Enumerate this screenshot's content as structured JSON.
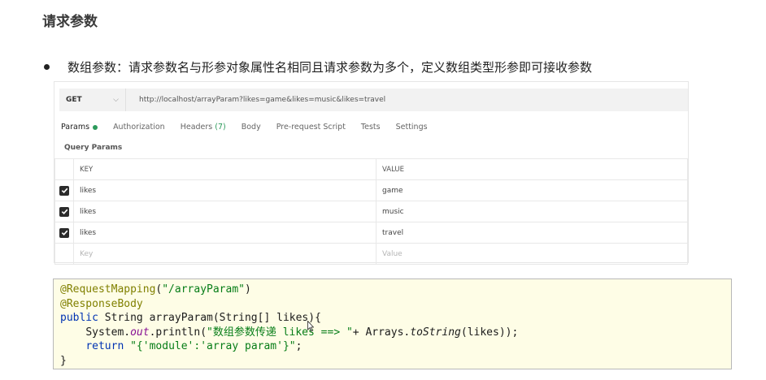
{
  "heading": "请求参数",
  "bullet": "数组参数：请求参数名与形参对象属性名相同且请求参数为多个，定义数组类型形参即可接收参数",
  "request": {
    "method": "GET",
    "url": "http://localhost/arrayParam?likes=game&likes=music&likes=travel"
  },
  "tabs": [
    {
      "label": "Params",
      "active": true
    },
    {
      "label": "Authorization"
    },
    {
      "label": "Headers",
      "count": "(7)"
    },
    {
      "label": "Body"
    },
    {
      "label": "Pre-request Script"
    },
    {
      "label": "Tests"
    },
    {
      "label": "Settings"
    }
  ],
  "query_params": {
    "title": "Query Params",
    "headers": [
      "KEY",
      "VALUE"
    ],
    "rows": [
      {
        "key": "likes",
        "value": "game",
        "checked": true
      },
      {
        "key": "likes",
        "value": "music",
        "checked": true
      },
      {
        "key": "likes",
        "value": "travel",
        "checked": true
      }
    ],
    "placeholder": {
      "key": "Key",
      "value": "Value"
    }
  },
  "code": {
    "line1_annotation": "@RequestMapping",
    "line1_path": "\"/arrayParam\"",
    "line2_annotation": "@ResponseBody",
    "line3_kw": "public",
    "line3_rest": " String arrayParam(String[] likes){",
    "line4_obj": "System.",
    "line4_field": "out",
    "line4_call": ".println(",
    "line4_str": "\"数组参数传递 likes ==> \"",
    "line4_plus": "+ Arrays.",
    "line4_method": "toString",
    "line4_end": "(likes));",
    "line5_kw": "return",
    "line5_str": "\"{'module':'array param'}\"",
    "line5_end": ";",
    "line6": "}"
  }
}
